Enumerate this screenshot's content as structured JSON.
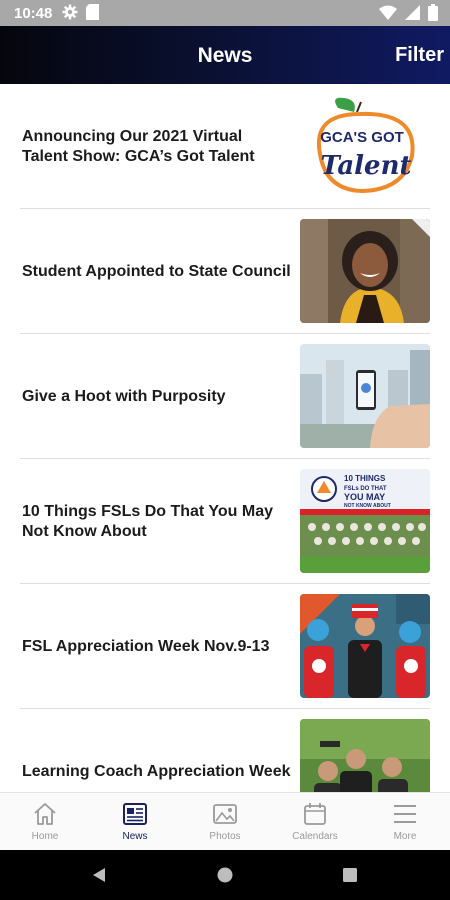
{
  "status_bar": {
    "time": "10:48"
  },
  "header": {
    "title": "News",
    "filter_label": "Filter"
  },
  "news": [
    {
      "title": "Announcing Our 2021 Virtual Talent Show: GCA’s Got Talent",
      "thumb_text_1": "GCA'S GOT",
      "thumb_text_2": "Talent"
    },
    {
      "title": "Student Appointed to State Council"
    },
    {
      "title": "Give a Hoot with Purposity"
    },
    {
      "title": "10 Things FSLs Do That You May Not Know About",
      "thumb_text_1": "10 THINGS",
      "thumb_text_2": "FSLs DO THAT",
      "thumb_text_3": "YOU MAY",
      "thumb_text_4": "NOT KNOW ABOUT"
    },
    {
      "title": "FSL Appreciation Week Nov.9-13"
    },
    {
      "title": "Learning Coach Appreciation Week"
    }
  ],
  "bottom_nav": [
    {
      "label": "Home",
      "icon": "home-icon"
    },
    {
      "label": "News",
      "icon": "news-icon",
      "active": true
    },
    {
      "label": "Photos",
      "icon": "photos-icon"
    },
    {
      "label": "Calendars",
      "icon": "calendar-icon"
    },
    {
      "label": "More",
      "icon": "menu-icon"
    }
  ],
  "colors": {
    "header_dark": "#05060d",
    "header_blue": "#101a63",
    "active_nav": "#1a2260",
    "inactive_nav": "#9a9a9a"
  }
}
